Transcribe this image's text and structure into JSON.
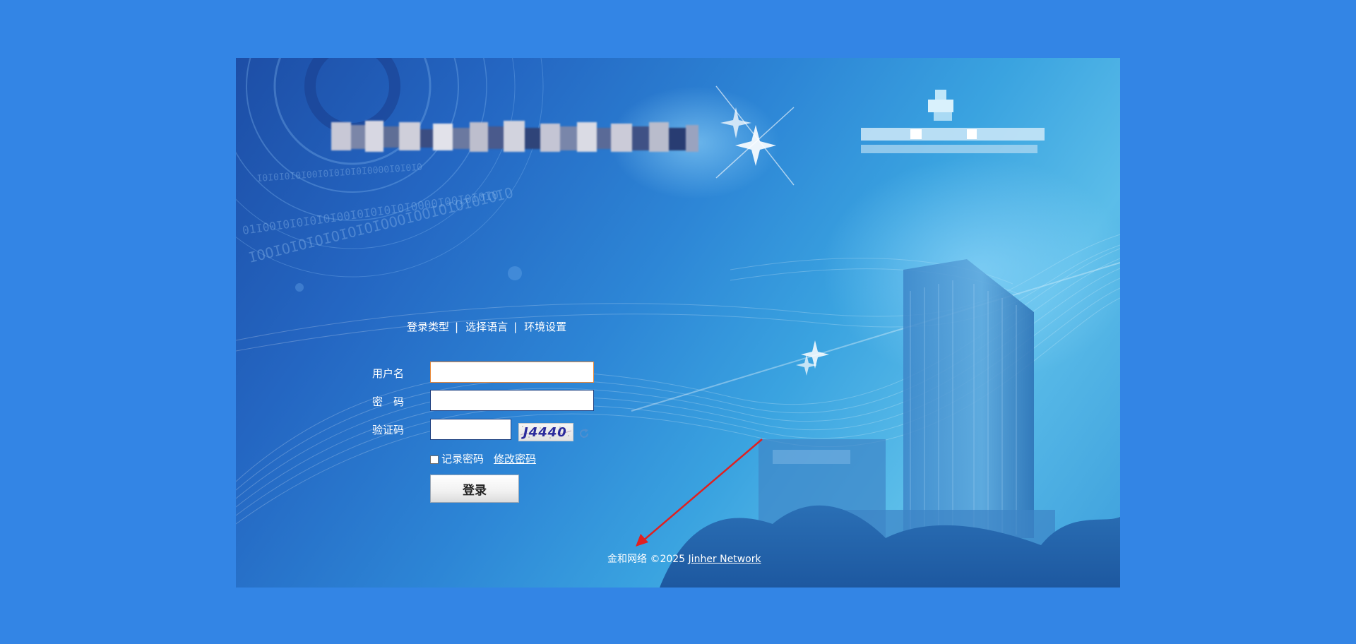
{
  "nav_links": {
    "login_type": "登录类型",
    "select_language": "选择语言",
    "environment_settings": "环境设置",
    "separator": "|"
  },
  "form": {
    "username_label": "用户名",
    "password_label": "密　码",
    "captcha_label": "验证码",
    "username_value": "",
    "password_value": "",
    "captcha_value": "",
    "captcha_image_text": "J4440",
    "remember_password_label": "记录密码",
    "remember_password_checked": false,
    "change_password_link": "修改密码",
    "login_button": "登录"
  },
  "footer": {
    "text": "金和网络 ©2025",
    "link": "Jinher Network"
  },
  "icons": {
    "captcha_refresh": "refresh-icon",
    "annotation": "red-arrow-icon"
  },
  "colors": {
    "page_background": "#3385e5",
    "input_focus_border": "#e8893a",
    "annotation_arrow": "#e02020"
  }
}
